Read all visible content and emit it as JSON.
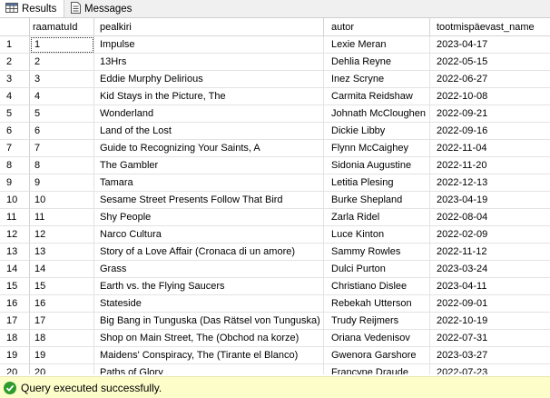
{
  "tabs": {
    "results_label": "Results",
    "messages_label": "Messages"
  },
  "columns": [
    "raamatuId",
    "pealkiri",
    "autor",
    "tootmispäevast_name"
  ],
  "rows": [
    [
      "1",
      "1",
      "Impulse",
      "Lexie Meran",
      "2023-04-17"
    ],
    [
      "2",
      "2",
      "13Hrs",
      "Dehlia Reyne",
      "2022-05-15"
    ],
    [
      "3",
      "3",
      "Eddie Murphy Delirious",
      "Inez Scryne",
      "2022-06-27"
    ],
    [
      "4",
      "4",
      "Kid Stays in the Picture, The",
      "Carmita Reidshaw",
      "2022-10-08"
    ],
    [
      "5",
      "5",
      "Wonderland",
      "Johnath McCloughen",
      "2022-09-21"
    ],
    [
      "6",
      "6",
      "Land of the Lost",
      "Dickie Libby",
      "2022-09-16"
    ],
    [
      "7",
      "7",
      "Guide to Recognizing Your Saints, A",
      "Flynn McCaighey",
      "2022-11-04"
    ],
    [
      "8",
      "8",
      "The Gambler",
      "Sidonia Augustine",
      "2022-11-20"
    ],
    [
      "9",
      "9",
      "Tamara",
      "Letitia Plesing",
      "2022-12-13"
    ],
    [
      "10",
      "10",
      "Sesame Street Presents Follow That Bird",
      "Burke Shepland",
      "2023-04-19"
    ],
    [
      "11",
      "11",
      "Shy People",
      "Zarla Ridel",
      "2022-08-04"
    ],
    [
      "12",
      "12",
      "Narco Cultura",
      "Luce Kinton",
      "2022-02-09"
    ],
    [
      "13",
      "13",
      "Story of a Love Affair (Cronaca di un amore)",
      "Sammy Rowles",
      "2022-11-12"
    ],
    [
      "14",
      "14",
      "Grass",
      "Dulci Purton",
      "2023-03-24"
    ],
    [
      "15",
      "15",
      "Earth vs. the Flying Saucers",
      "Christiano Dislee",
      "2023-04-11"
    ],
    [
      "16",
      "16",
      "Stateside",
      "Rebekah Utterson",
      "2022-09-01"
    ],
    [
      "17",
      "17",
      "Big Bang in Tunguska (Das Rätsel von Tunguska)",
      "Trudy Reijmers",
      "2022-10-19"
    ],
    [
      "18",
      "18",
      "Shop on Main Street, The (Obchod na korze)",
      "Oriana Vedenisov",
      "2022-07-31"
    ],
    [
      "19",
      "19",
      "Maidens' Conspiracy, The (Tirante el Blanco)",
      "Gwenora Garshore",
      "2023-03-27"
    ],
    [
      "20",
      "20",
      "Paths of Glory",
      "Francyne Draude",
      "2022-07-23"
    ]
  ],
  "status": {
    "message": "Query executed successfully.",
    "color": "#fdfdca"
  }
}
